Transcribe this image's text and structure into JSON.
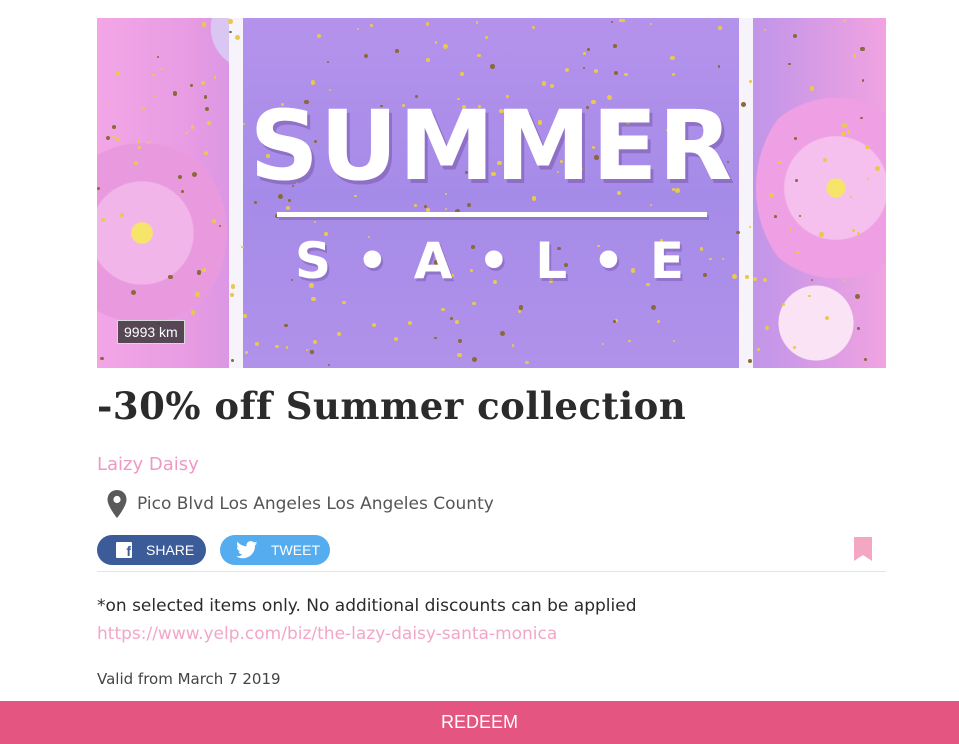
{
  "hero": {
    "title": "SUMMER",
    "subtitle": "S • A • L • E",
    "distance": "9993 km"
  },
  "deal": {
    "title": "-30% off Summer collection",
    "merchant": "Laizy Daisy",
    "location_icon": "map-pin-icon",
    "address": "Pico Blvd Los Angeles Los Angeles County"
  },
  "social": {
    "share_label": "SHARE",
    "share_icon": "facebook-icon",
    "tweet_label": "TWEET",
    "tweet_icon": "twitter-icon",
    "bookmark_icon": "bookmark-icon"
  },
  "details": {
    "terms": "*on selected items only. No additional discounts can be applied",
    "link": "https://www.yelp.com/biz/the-lazy-daisy-santa-monica",
    "validity": "Valid from March 7 2019"
  },
  "actions": {
    "redeem_label": "REDEEM"
  },
  "colors": {
    "accent": "#e45582",
    "merchant": "#ef9ac4",
    "facebook": "#3b5b99",
    "twitter": "#55acee",
    "bookmark": "#f4a7c3"
  }
}
